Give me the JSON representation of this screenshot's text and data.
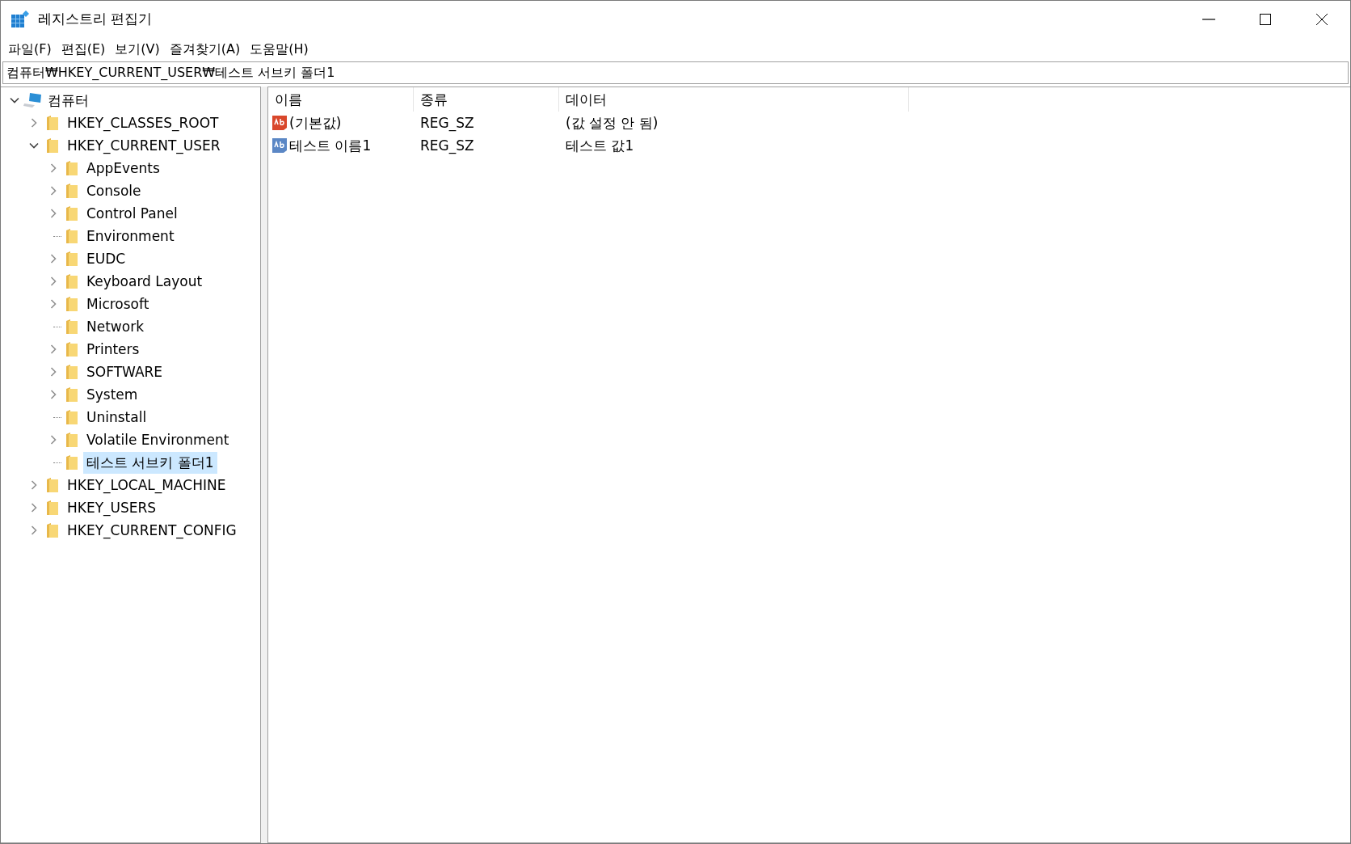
{
  "window": {
    "title": "레지스트리 편집기"
  },
  "menu": [
    "파일(F)",
    "편집(E)",
    "보기(V)",
    "즐겨찾기(A)",
    "도움말(H)"
  ],
  "address": {
    "value": "컴퓨터₩HKEY_CURRENT_USER₩테스트 서브키 폴더1"
  },
  "tree": [
    {
      "label": "컴퓨터",
      "kind": "computer",
      "has_subkeys": true,
      "expanded": true,
      "selected": false,
      "children": [
        {
          "label": "HKEY_CLASSES_ROOT",
          "kind": "folder",
          "has_subkeys": true,
          "expanded": false,
          "selected": false
        },
        {
          "label": "HKEY_CURRENT_USER",
          "kind": "folder",
          "has_subkeys": true,
          "expanded": true,
          "selected": false,
          "children": [
            {
              "label": "AppEvents",
              "kind": "folder",
              "has_subkeys": true,
              "expanded": false,
              "selected": false
            },
            {
              "label": "Console",
              "kind": "folder",
              "has_subkeys": true,
              "expanded": false,
              "selected": false
            },
            {
              "label": "Control Panel",
              "kind": "folder",
              "has_subkeys": true,
              "expanded": false,
              "selected": false
            },
            {
              "label": "Environment",
              "kind": "folder",
              "has_subkeys": false,
              "selected": false
            },
            {
              "label": "EUDC",
              "kind": "folder",
              "has_subkeys": true,
              "expanded": false,
              "selected": false
            },
            {
              "label": "Keyboard Layout",
              "kind": "folder",
              "has_subkeys": true,
              "expanded": false,
              "selected": false
            },
            {
              "label": "Microsoft",
              "kind": "folder",
              "has_subkeys": true,
              "expanded": false,
              "selected": false
            },
            {
              "label": "Network",
              "kind": "folder",
              "has_subkeys": false,
              "selected": false
            },
            {
              "label": "Printers",
              "kind": "folder",
              "has_subkeys": true,
              "expanded": false,
              "selected": false
            },
            {
              "label": "SOFTWARE",
              "kind": "folder",
              "has_subkeys": true,
              "expanded": false,
              "selected": false
            },
            {
              "label": "System",
              "kind": "folder",
              "has_subkeys": true,
              "expanded": false,
              "selected": false
            },
            {
              "label": "Uninstall",
              "kind": "folder",
              "has_subkeys": false,
              "selected": false
            },
            {
              "label": "Volatile Environment",
              "kind": "folder",
              "has_subkeys": true,
              "expanded": false,
              "selected": false
            },
            {
              "label": "테스트 서브키 폴더1",
              "kind": "folder",
              "has_subkeys": false,
              "selected": true
            }
          ]
        },
        {
          "label": "HKEY_LOCAL_MACHINE",
          "kind": "folder",
          "has_subkeys": true,
          "expanded": false,
          "selected": false
        },
        {
          "label": "HKEY_USERS",
          "kind": "folder",
          "has_subkeys": true,
          "expanded": false,
          "selected": false
        },
        {
          "label": "HKEY_CURRENT_CONFIG",
          "kind": "folder",
          "has_subkeys": true,
          "expanded": false,
          "selected": false
        }
      ]
    }
  ],
  "table": {
    "columns": [
      "이름",
      "종류",
      "데이터"
    ],
    "rows": [
      {
        "name": "(기본값)",
        "type": "REG_SZ",
        "data": "(값 설정 안 됨)",
        "color": "#d9472b"
      },
      {
        "name": "테스트 이름1",
        "type": "REG_SZ",
        "data": "테스트 값1",
        "color": "#5b87c5"
      }
    ]
  }
}
